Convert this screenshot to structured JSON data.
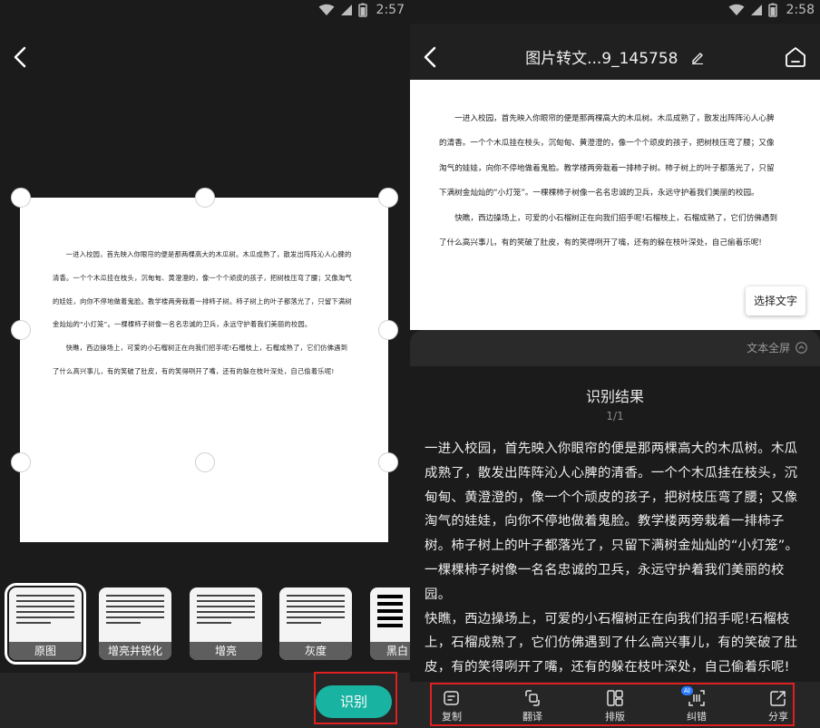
{
  "left_screen": {
    "status": {
      "time": "2:57"
    },
    "filters": [
      {
        "label": "原图",
        "selected": true
      },
      {
        "label": "增亮并锐化",
        "selected": false
      },
      {
        "label": "增亮",
        "selected": false
      },
      {
        "label": "灰度",
        "selected": false
      },
      {
        "label": "黑白",
        "selected": false
      }
    ],
    "recognize_label": "识别",
    "document_paragraphs": [
      "一进入校园，首先映入你眼帘的便是那两棵高大的木瓜树。木瓜成熟了，散发出阵阵沁人心脾的清香。一个个木瓜挂在枝头，沉甸甸、黄澄澄的，像一个个顽皮的孩子，把树枝压弯了腰；又像淘气的娃娃，向你不停地做着鬼脸。教学楼两旁栽着一排柿子树。柿子树上的叶子都落光了，只留下满树金灿灿的“小灯笼”。一棵棵柿子树像一名名忠诚的卫兵，永远守护着我们美丽的校园。",
      "快瞧，西边操场上，可爱的小石榴树正在向我们招手呢!石榴枝上，石榴成熟了，它们仿佛遇到了什么高兴事儿，有的笑破了肚皮，有的笑得咧开了嘴，还有的躲在枝叶深处，自己偷着乐呢!"
    ]
  },
  "right_screen": {
    "status": {
      "time": "2:58"
    },
    "title": "图片转文...9_145758",
    "preview_paragraphs": [
      "一进入校园，首先映入你眼帘的便是那两棵高大的木瓜树。木瓜成熟了，散发出阵阵沁人心脾的清香。一个个木瓜挂在枝头，沉甸甸、黄澄澄的，像一个个顽皮的孩子，把树枝压弯了腰；又像淘气的娃娃，向你不停地做着鬼脸。教学楼两旁栽着一排柿子树。柿子树上的叶子都落光了，只留下满树金灿灿的“小灯笼”。一棵棵柿子树像一名名忠诚的卫兵，永远守护着我们美丽的校园。",
      "快瞧，西边操场上，可爱的小石榴树正在向我们招手呢!石榴枝上，石榴成熟了，它们仿佛遇到了什么高兴事儿，有的笑破了肚皮，有的笑得咧开了嘴，还有的躲在枝叶深处，自己偷着乐呢!"
    ],
    "select_text_label": "选择文字",
    "fullscreen_label": "文本全屏",
    "result_title": "识别结果",
    "result_page": "1/1",
    "result_paragraph_1": "一进入校园，首先映入你眼帘的便是那两棵高大的木瓜树。木瓜成熟了，散发出阵阵沁人心脾的清香。一个个木瓜挂在枝头，沉甸甸、黄澄澄的，像一个个顽皮的孩子，把树枝压弯了腰；又像淘气的娃娃，向你不停地做着鬼脸。教学楼两旁栽着一排柿子树。柿子树上的叶子都落光了，只留下满树金灿灿的“小灯笼”。一棵棵柿子树像一名名忠诚的卫兵，永远守护着我们美丽的校园。",
    "result_paragraph_2": "快瞧，西边操场上，可爱的小石榴树正在向我们招手呢!石榴枝上，石榴成熟了，它们仿佛遇到了什么高兴事儿，有的笑破了肚皮，有的笑得咧开了嘴，还有的躲在枝叶深处，自己偷着乐呢!",
    "actions": [
      {
        "label": "复制",
        "icon": "copy-icon"
      },
      {
        "label": "翻译",
        "icon": "translate-icon"
      },
      {
        "label": "排版",
        "icon": "layout-icon"
      },
      {
        "label": "纠错",
        "icon": "correct-icon"
      },
      {
        "label": "分享",
        "icon": "share-icon"
      }
    ],
    "ai_badge": "AI"
  },
  "colors": {
    "accent": "#19b3a2",
    "highlight_box": "#e02020",
    "ai_badge": "#2b7cff"
  }
}
